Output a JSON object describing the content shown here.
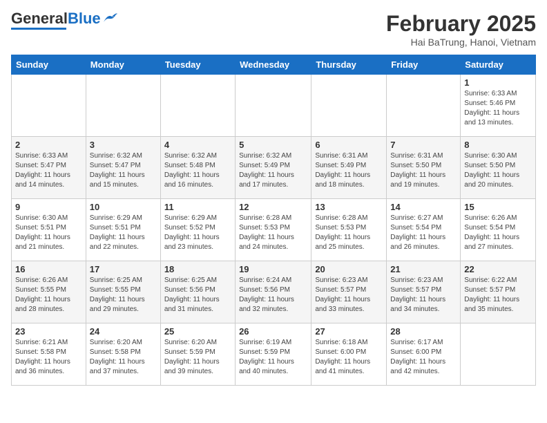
{
  "header": {
    "logo_general": "General",
    "logo_blue": "Blue",
    "month_title": "February 2025",
    "location": "Hai BaTrung, Hanoi, Vietnam"
  },
  "days_of_week": [
    "Sunday",
    "Monday",
    "Tuesday",
    "Wednesday",
    "Thursday",
    "Friday",
    "Saturday"
  ],
  "weeks": [
    [
      {
        "day": "",
        "info": ""
      },
      {
        "day": "",
        "info": ""
      },
      {
        "day": "",
        "info": ""
      },
      {
        "day": "",
        "info": ""
      },
      {
        "day": "",
        "info": ""
      },
      {
        "day": "",
        "info": ""
      },
      {
        "day": "1",
        "info": "Sunrise: 6:33 AM\nSunset: 5:46 PM\nDaylight: 11 hours and 13 minutes."
      }
    ],
    [
      {
        "day": "2",
        "info": "Sunrise: 6:33 AM\nSunset: 5:47 PM\nDaylight: 11 hours and 14 minutes."
      },
      {
        "day": "3",
        "info": "Sunrise: 6:32 AM\nSunset: 5:47 PM\nDaylight: 11 hours and 15 minutes."
      },
      {
        "day": "4",
        "info": "Sunrise: 6:32 AM\nSunset: 5:48 PM\nDaylight: 11 hours and 16 minutes."
      },
      {
        "day": "5",
        "info": "Sunrise: 6:32 AM\nSunset: 5:49 PM\nDaylight: 11 hours and 17 minutes."
      },
      {
        "day": "6",
        "info": "Sunrise: 6:31 AM\nSunset: 5:49 PM\nDaylight: 11 hours and 18 minutes."
      },
      {
        "day": "7",
        "info": "Sunrise: 6:31 AM\nSunset: 5:50 PM\nDaylight: 11 hours and 19 minutes."
      },
      {
        "day": "8",
        "info": "Sunrise: 6:30 AM\nSunset: 5:50 PM\nDaylight: 11 hours and 20 minutes."
      }
    ],
    [
      {
        "day": "9",
        "info": "Sunrise: 6:30 AM\nSunset: 5:51 PM\nDaylight: 11 hours and 21 minutes."
      },
      {
        "day": "10",
        "info": "Sunrise: 6:29 AM\nSunset: 5:51 PM\nDaylight: 11 hours and 22 minutes."
      },
      {
        "day": "11",
        "info": "Sunrise: 6:29 AM\nSunset: 5:52 PM\nDaylight: 11 hours and 23 minutes."
      },
      {
        "day": "12",
        "info": "Sunrise: 6:28 AM\nSunset: 5:53 PM\nDaylight: 11 hours and 24 minutes."
      },
      {
        "day": "13",
        "info": "Sunrise: 6:28 AM\nSunset: 5:53 PM\nDaylight: 11 hours and 25 minutes."
      },
      {
        "day": "14",
        "info": "Sunrise: 6:27 AM\nSunset: 5:54 PM\nDaylight: 11 hours and 26 minutes."
      },
      {
        "day": "15",
        "info": "Sunrise: 6:26 AM\nSunset: 5:54 PM\nDaylight: 11 hours and 27 minutes."
      }
    ],
    [
      {
        "day": "16",
        "info": "Sunrise: 6:26 AM\nSunset: 5:55 PM\nDaylight: 11 hours and 28 minutes."
      },
      {
        "day": "17",
        "info": "Sunrise: 6:25 AM\nSunset: 5:55 PM\nDaylight: 11 hours and 29 minutes."
      },
      {
        "day": "18",
        "info": "Sunrise: 6:25 AM\nSunset: 5:56 PM\nDaylight: 11 hours and 31 minutes."
      },
      {
        "day": "19",
        "info": "Sunrise: 6:24 AM\nSunset: 5:56 PM\nDaylight: 11 hours and 32 minutes."
      },
      {
        "day": "20",
        "info": "Sunrise: 6:23 AM\nSunset: 5:57 PM\nDaylight: 11 hours and 33 minutes."
      },
      {
        "day": "21",
        "info": "Sunrise: 6:23 AM\nSunset: 5:57 PM\nDaylight: 11 hours and 34 minutes."
      },
      {
        "day": "22",
        "info": "Sunrise: 6:22 AM\nSunset: 5:57 PM\nDaylight: 11 hours and 35 minutes."
      }
    ],
    [
      {
        "day": "23",
        "info": "Sunrise: 6:21 AM\nSunset: 5:58 PM\nDaylight: 11 hours and 36 minutes."
      },
      {
        "day": "24",
        "info": "Sunrise: 6:20 AM\nSunset: 5:58 PM\nDaylight: 11 hours and 37 minutes."
      },
      {
        "day": "25",
        "info": "Sunrise: 6:20 AM\nSunset: 5:59 PM\nDaylight: 11 hours and 39 minutes."
      },
      {
        "day": "26",
        "info": "Sunrise: 6:19 AM\nSunset: 5:59 PM\nDaylight: 11 hours and 40 minutes."
      },
      {
        "day": "27",
        "info": "Sunrise: 6:18 AM\nSunset: 6:00 PM\nDaylight: 11 hours and 41 minutes."
      },
      {
        "day": "28",
        "info": "Sunrise: 6:17 AM\nSunset: 6:00 PM\nDaylight: 11 hours and 42 minutes."
      },
      {
        "day": "",
        "info": ""
      }
    ]
  ]
}
